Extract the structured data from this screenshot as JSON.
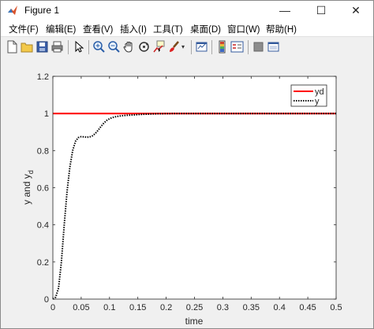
{
  "window": {
    "title": "Figure 1",
    "minimize": "—",
    "maximize": "☐",
    "close": "✕"
  },
  "menu": [
    "文件(F)",
    "编辑(E)",
    "查看(V)",
    "插入(I)",
    "工具(T)",
    "桌面(D)",
    "窗口(W)",
    "帮助(H)"
  ],
  "toolbar": [
    "new-figure-icon",
    "open-file-icon",
    "save-icon",
    "print-icon",
    "edit-plot-arrow-icon",
    "zoom-in-icon",
    "zoom-out-icon",
    "pan-hand-icon",
    "rotate-3d-icon",
    "data-cursor-icon",
    "brush-icon",
    "link-plot-icon",
    "insert-colorbar-icon",
    "insert-legend-icon",
    "hide-plot-tools-icon",
    "show-plot-tools-icon"
  ],
  "chart_data": {
    "type": "line",
    "title": "",
    "xlabel": "time",
    "ylabel": "y and y",
    "ylabel_subscript": "d",
    "xlim": [
      0,
      0.5
    ],
    "ylim": [
      0,
      1.2
    ],
    "xticks": [
      "0",
      "0.05",
      "0.1",
      "0.15",
      "0.2",
      "0.25",
      "0.3",
      "0.35",
      "0.4",
      "0.45",
      "0.5"
    ],
    "yticks": [
      "0",
      "0.2",
      "0.4",
      "0.6",
      "0.8",
      "1",
      "1.2"
    ],
    "legend_position": "top-right",
    "series": [
      {
        "name": "yd",
        "color": "#ff0000",
        "style": "solid",
        "x": [
          0,
          0.5
        ],
        "y": [
          1,
          1
        ]
      },
      {
        "name": "y",
        "color": "#000000",
        "style": "dotted",
        "x": [
          0,
          0.005,
          0.01,
          0.015,
          0.02,
          0.025,
          0.03,
          0.035,
          0.04,
          0.045,
          0.05,
          0.055,
          0.06,
          0.065,
          0.07,
          0.075,
          0.08,
          0.085,
          0.09,
          0.095,
          0.1,
          0.105,
          0.11,
          0.115,
          0.12,
          0.13,
          0.14,
          0.15,
          0.16,
          0.17,
          0.18,
          0.2,
          0.22,
          0.25,
          0.3,
          0.35,
          0.4,
          0.45,
          0.5
        ],
        "y": [
          0,
          0.01,
          0.06,
          0.2,
          0.4,
          0.58,
          0.71,
          0.8,
          0.85,
          0.87,
          0.875,
          0.874,
          0.872,
          0.874,
          0.88,
          0.892,
          0.91,
          0.93,
          0.948,
          0.962,
          0.972,
          0.978,
          0.982,
          0.985,
          0.987,
          0.99,
          0.992,
          0.994,
          0.996,
          0.997,
          0.998,
          0.999,
          1.0,
          1.0,
          1.0,
          1.0,
          1.0,
          1.0,
          1.0
        ]
      }
    ]
  }
}
